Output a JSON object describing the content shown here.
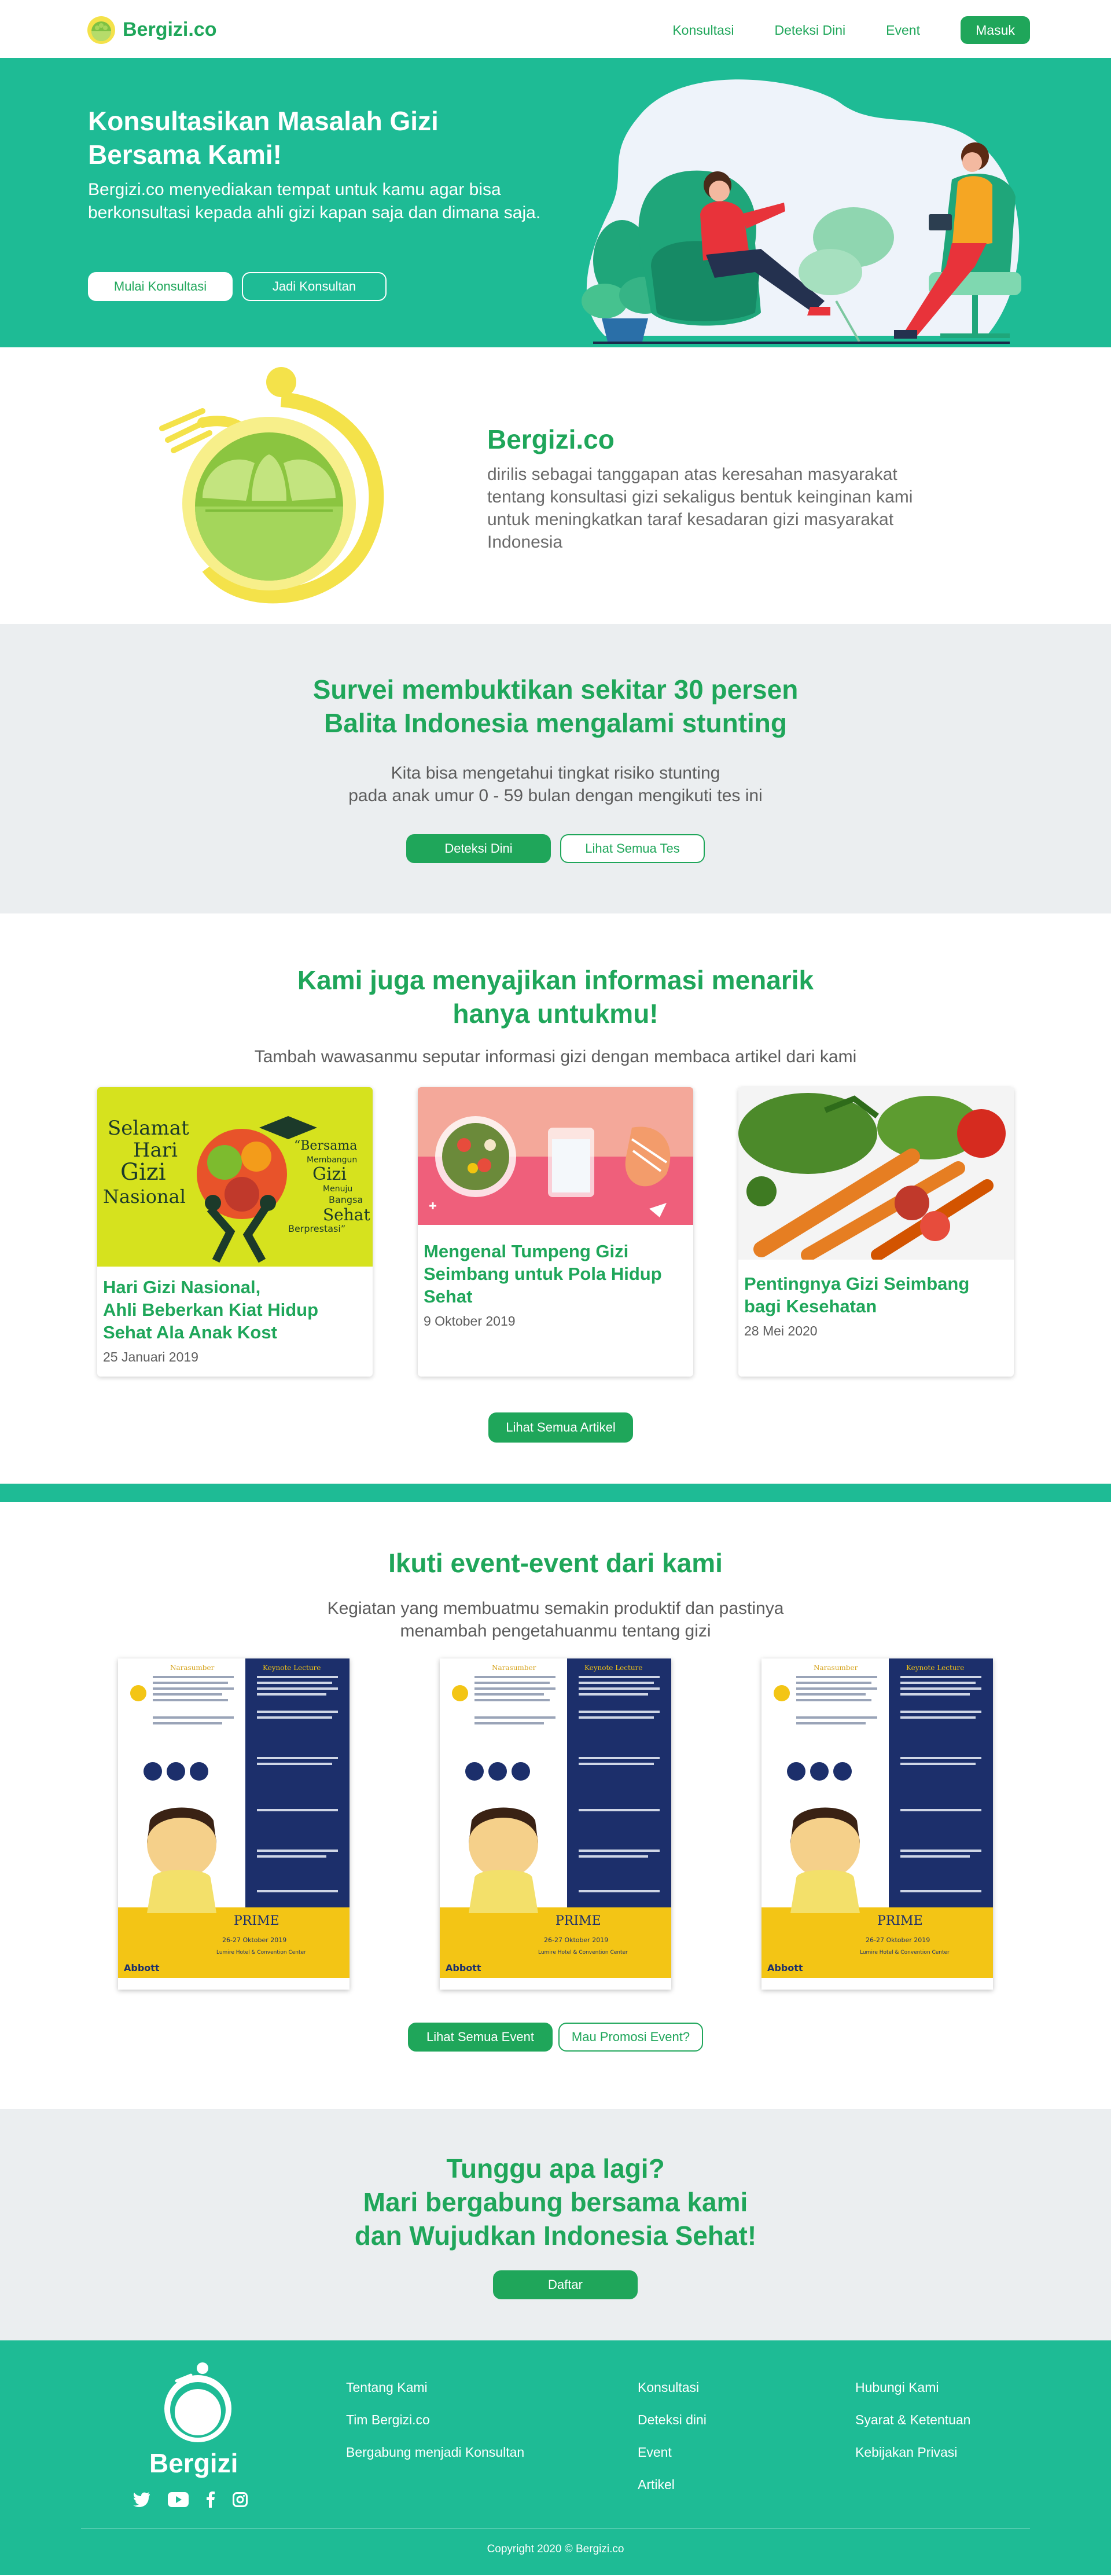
{
  "nav": {
    "brand": "Bergizi.co",
    "links": [
      "Konsultasi",
      "Deteksi Dini",
      "Event"
    ],
    "login": "Masuk"
  },
  "hero": {
    "title": "Konsultasikan Masalah Gizi Bersama Kami!",
    "desc": "Bergizi.co menyediakan tempat untuk kamu agar bisa berkonsultasi kepada ahli gizi kapan saja dan dimana saja.",
    "btn_primary": "Mulai Konsultasi",
    "btn_secondary": "Jadi Konsultan"
  },
  "about": {
    "title": "Bergizi.co",
    "desc": "dirilis sebagai tanggapan atas keresahan masyarakat tentang konsultasi gizi sekaligus bentuk keinginan kami untuk meningkatkan taraf kesadaran gizi masyarakat Indonesia"
  },
  "survey": {
    "title": "Survei membuktikan sekitar 30 persen\nBalita Indonesia mengalami stunting",
    "desc": "Kita bisa mengetahui tingkat risiko stunting\npada anak umur 0 - 59 bulan dengan mengikuti tes ini",
    "btn_primary": "Deteksi Dini",
    "btn_secondary": "Lihat Semua Tes"
  },
  "articles": {
    "title": "Kami juga menyajikan informasi menarik\nhanya untukmu!",
    "subtitle": "Tambah wawasanmu seputar informasi gizi dengan membaca artikel dari kami",
    "items": [
      {
        "title": "Hari Gizi Nasional,\nAhli Beberkan Kiat Hidup\nSehat Ala Anak Kost",
        "date": "25 Januari 2019",
        "img_text": [
          "Selamat",
          "Hari",
          "Gizi",
          "Nasional",
          "“Bersama",
          "Membangun",
          "Gizi",
          "Menuju",
          "Bangsa",
          "Sehat",
          "Berprestasi”"
        ]
      },
      {
        "title": "Mengenal Tumpeng Gizi\nSeimbang untuk Pola Hidup\nSehat",
        "date": "9 Oktober 2019"
      },
      {
        "title": "Pentingnya Gizi Seimbang\nbagi Kesehatan",
        "date": "28 Mei 2020"
      }
    ],
    "btn": "Lihat Semua Artikel"
  },
  "events": {
    "title": "Ikuti event-event dari kami",
    "subtitle": "Kegiatan yang membuatmu semakin produktif dan pastinya\nmenambah pengetahuanmu tentang gizi",
    "poster": {
      "left_heading": "Narasumber",
      "right_heading": "Keynote Lecture",
      "event_name": "PRIME",
      "date": "26-27 Oktober 2019",
      "venue": "Lumire Hotel & Convention Center",
      "sponsor": "Abbott"
    },
    "btn_primary": "Lihat Semua Event",
    "btn_secondary": "Mau Promosi Event?"
  },
  "cta": {
    "title": "Tunggu apa lagi?\nMari bergabung bersama kami\ndan Wujudkan Indonesia Sehat!",
    "btn": "Daftar"
  },
  "footer": {
    "brand": "Bergizi",
    "col1": [
      "Tentang Kami",
      "Tim Bergizi.co",
      "Bergabung menjadi Konsultan"
    ],
    "col2": [
      "Konsultasi",
      "Deteksi dini",
      "Event",
      "Artikel"
    ],
    "col3": [
      "Hubungi Kami",
      "Syarat & Ketentuan",
      "Kebijakan Privasi"
    ],
    "copyright": "Copyright 2020 © Bergizi.co"
  },
  "colors": {
    "brand_green": "#1fa65a",
    "teal": "#1ebb95",
    "light_gray": "#ebeef0"
  }
}
